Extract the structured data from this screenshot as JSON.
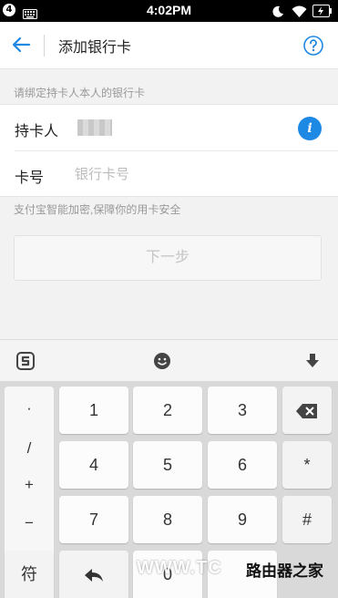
{
  "status_bar": {
    "notification_count": "4",
    "time": "4:02PM"
  },
  "header": {
    "title": "添加银行卡"
  },
  "hints": {
    "bind_hint": "请绑定持卡人本人的银行卡",
    "security_hint": "支付宝智能加密,保障你的用卡安全"
  },
  "form": {
    "holder_label": "持卡人",
    "card_label": "卡号",
    "card_placeholder": "银行卡号",
    "card_value": ""
  },
  "next_button": {
    "label": "下一步",
    "enabled": false
  },
  "keyboard": {
    "symbols": [
      "·",
      "/",
      "+",
      "−"
    ],
    "rows": [
      [
        "1",
        "2",
        "3"
      ],
      [
        "4",
        "5",
        "6"
      ],
      [
        "7",
        "8",
        "9"
      ]
    ],
    "side_keys": [
      "*",
      "#"
    ],
    "symbol_key": "符",
    "bottom_zero": "0"
  },
  "watermark": {
    "left": "WWW.TC",
    "right": "路由器之家"
  },
  "colors": {
    "accent": "#1e88e5",
    "background": "#f2f2f2"
  }
}
